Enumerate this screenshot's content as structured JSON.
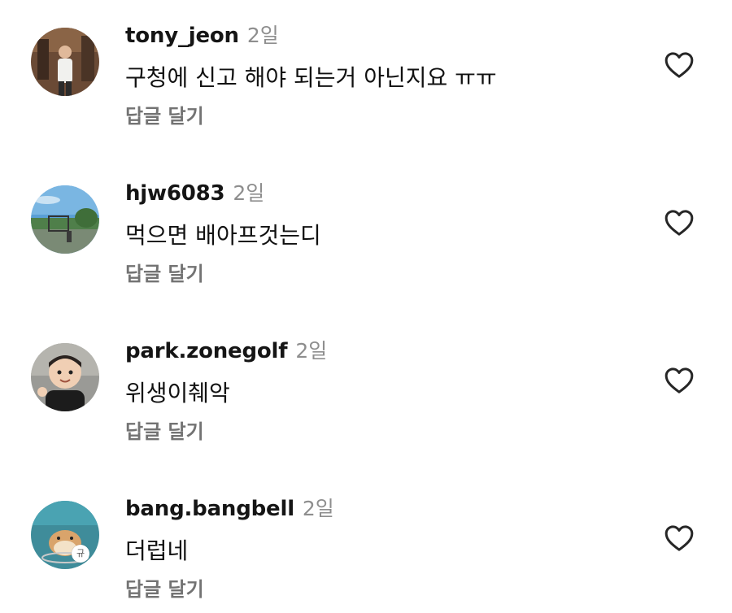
{
  "comments": [
    {
      "username": "tony_jeon",
      "time": "2일",
      "text": "구청에 신고 해야 되는거 아닌지요 ㅠㅠ",
      "reply_label": "답글 달기",
      "like_icon": "heart-outline-icon"
    },
    {
      "username": "hjw6083",
      "time": "2일",
      "text": "먹으면 배아프것는디",
      "reply_label": "답글 달기",
      "like_icon": "heart-outline-icon"
    },
    {
      "username": "park.zonegolf",
      "time": "2일",
      "text": "위생이췌악",
      "reply_label": "답글 달기",
      "like_icon": "heart-outline-icon"
    },
    {
      "username": "bang.bangbell",
      "time": "2일",
      "text": "더럽네",
      "reply_label": "답글 달기",
      "like_icon": "heart-outline-icon"
    }
  ],
  "avatar_badge": "규",
  "colors": {
    "username": "#151515",
    "meta": "#8e8e8e",
    "reply": "#737373",
    "text": "#111111"
  }
}
